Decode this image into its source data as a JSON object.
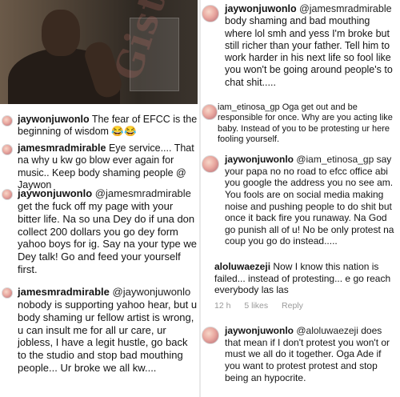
{
  "left": {
    "c1": {
      "handle": "jaywonjuwonlo",
      "text": " The fear of EFCC is the beginning of wisdom 😂😂"
    },
    "c2": {
      "handle": "jamesmradmirable",
      "text": " Eye service.... That na why u kw go blow ever again for music.. Keep body shaming people @ Jaywon"
    },
    "c3": {
      "handle": "jaywonjuwonlo",
      "mention": " @jamesmradmirable",
      "text": " get the fuck off my page with your bitter life. Na so una Dey do if una don collect 200 dollars you go dey form yahoo boys for ig. Say na your type we Dey talk! Go and feed your yourself first."
    },
    "c4": {
      "handle": "jamesmradmirable",
      "mention": " @jaywonjuwonlo",
      "text": " nobody is supporting yahoo hear, but u body shaming ur fellow artist is wrong, u can insult me for all ur care, ur jobless, I have a legit hustle, go back to the studio and stop bad mouthing people... Ur broke we all kw...."
    }
  },
  "right": {
    "c5": {
      "handle": "jaywonjuwonlo",
      "mention": " @jamesmradmirable",
      "text": " body shaming and bad mouthing where lol smh and yess I'm broke but still richer than your father. Tell him to work harder in his next life so fool like you won't be going around people's to chat shit....."
    },
    "c6": {
      "handle": "iam_etinosa_gp",
      "text": " Oga get out and be responsible for once. Why are you acting like baby. Instead of you to be protesting ur here fooling yourself."
    },
    "c7": {
      "handle": "jaywonjuwonlo",
      "mention": " @iam_etinosa_gp",
      "text": " say your papa no no road to efcc office abi you google the address you no see am. You fools are on social media making noise and pushing people to do shit but once it back fire you runaway. Na God go punish all of u! No be only protest na coup you go do instead....."
    },
    "c8": {
      "handle": "aloluwaezeji",
      "text": " Now I know this nation is failed... instead of protesting... e go reach everybody las las",
      "meta": {
        "time": "12 h",
        "likes": "5 likes",
        "reply": "Reply"
      }
    },
    "c9": {
      "handle": "jaywonjuwonlo",
      "mention": " @aloluwaezeji",
      "text": " does that mean if I don't protest you won't or must we all do it together. Oga Ade if you want to protest  protest and stop being an hypocrite."
    }
  },
  "watermark": "Gistlover.com",
  "colors": {
    "text": "#141414",
    "meta": "#999999",
    "background": "#ffffff"
  }
}
